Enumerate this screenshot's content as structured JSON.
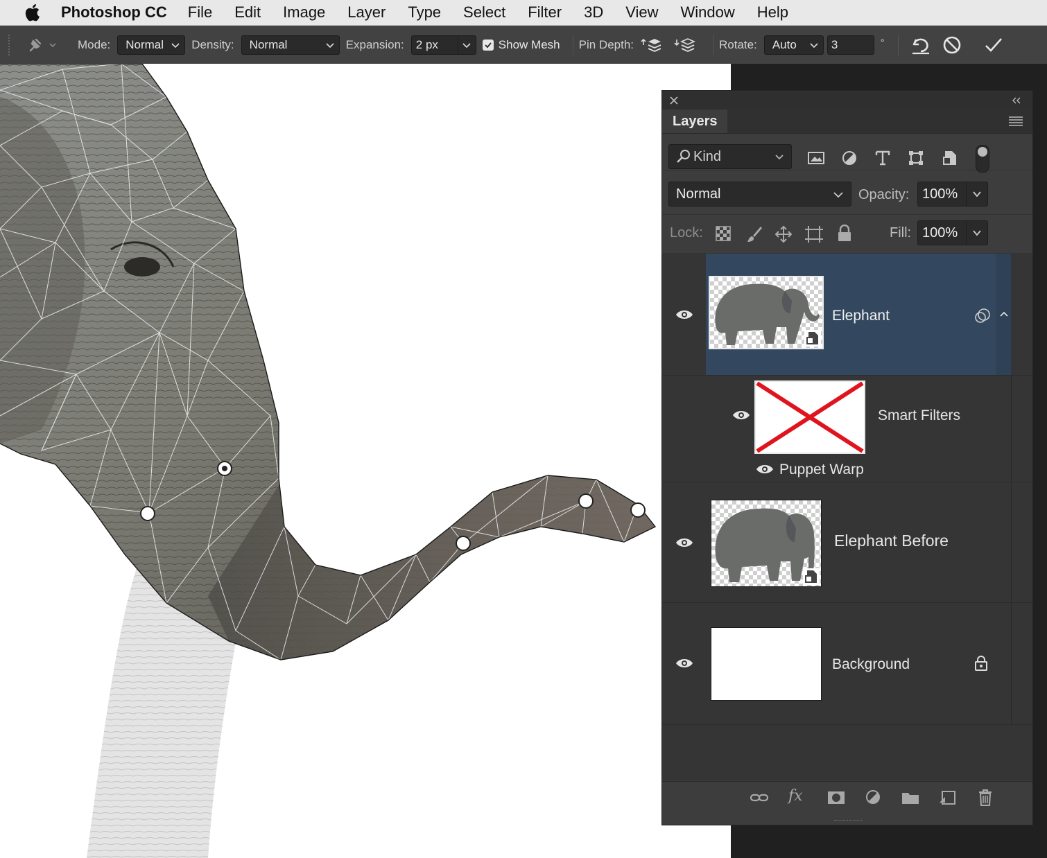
{
  "menubar": {
    "app_name": "Photoshop CC",
    "items": [
      "File",
      "Edit",
      "Image",
      "Layer",
      "Type",
      "Select",
      "Filter",
      "3D",
      "View",
      "Window",
      "Help"
    ]
  },
  "options": {
    "mode_label": "Mode:",
    "mode_value": "Normal",
    "density_label": "Density:",
    "density_value": "Normal",
    "expansion_label": "Expansion:",
    "expansion_value": "2 px",
    "show_mesh_label": "Show Mesh",
    "show_mesh_checked": true,
    "pin_depth_label": "Pin Depth:",
    "rotate_label": "Rotate:",
    "rotate_value": "Auto",
    "rotate_angle": "3",
    "degree_symbol": "°"
  },
  "layers_panel": {
    "tab_label": "Layers",
    "filter_kind": "Kind",
    "blend_mode": "Normal",
    "opacity_label": "Opacity:",
    "opacity_value": "100%",
    "lock_label": "Lock:",
    "fill_label": "Fill:",
    "fill_value": "100%",
    "layers": [
      {
        "name": "Elephant",
        "selected": true
      },
      {
        "name": "Smart Filters"
      },
      {
        "name": "Puppet Warp"
      },
      {
        "name": "Elephant Before"
      },
      {
        "name": "Background",
        "locked": true
      }
    ],
    "selection_color": "#33485f"
  },
  "colors": {
    "pin_fill": "#ffffff",
    "smart_filter_x": "#e0141e"
  }
}
